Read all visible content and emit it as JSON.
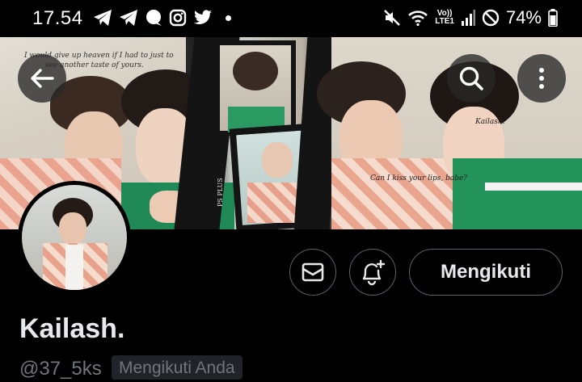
{
  "status_bar": {
    "time": "17.54",
    "network_top": "Vo))",
    "network_bottom": "LTE1",
    "battery": "74%",
    "left_icons": [
      "telegram-icon",
      "telegram-icon",
      "chat-bubble-icon",
      "instagram-icon",
      "twitter-icon"
    ],
    "right_icons": [
      "mute-icon",
      "wifi-icon",
      "signal-icon",
      "do-not-disturb-icon",
      "battery-icon"
    ]
  },
  "header": {
    "back_icon": "arrow-left-icon",
    "search_icon": "search-icon",
    "more_icon": "more-vertical-icon"
  },
  "banner": {
    "script_1": "I would give up heaven if I had to just to",
    "script_2": "see another taste of yours.",
    "script_3": "Can I kiss your lips, babe?",
    "script_4": "Kailash.",
    "film_text": "PS PLUS"
  },
  "profile": {
    "display_name": "Kailash.",
    "handle": "@37_5ks",
    "follows_you": "Mengikuti Anda",
    "follow_button": "Mengikuti",
    "message_icon": "envelope-icon",
    "notify_icon": "bell-plus-icon"
  },
  "colors": {
    "background": "#000000",
    "text_primary": "#e7e9ea",
    "text_secondary": "#71767b",
    "border": "#5b6167",
    "badge_bg": "#202327"
  }
}
